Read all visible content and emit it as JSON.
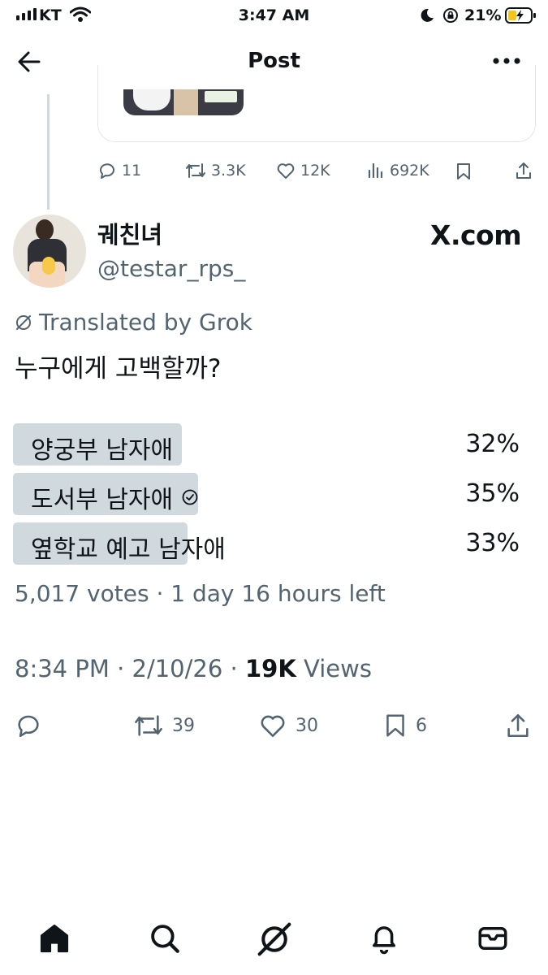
{
  "status_bar": {
    "carrier": "KT",
    "time": "3:47 AM",
    "battery": "21%"
  },
  "nav": {
    "title": "Post"
  },
  "quoted_post_actions": {
    "replies": "11",
    "reposts": "3.3K",
    "likes": "12K",
    "views": "692K"
  },
  "author": {
    "name": "궤친녀",
    "handle": "@testar_rps_",
    "badge": "X.com"
  },
  "translated": "Translated by Grok",
  "tweet_text": "누구에게 고백할까?",
  "poll": {
    "options": [
      {
        "label": "양궁부 남자애",
        "percent": "32%",
        "value": 32,
        "selected": false
      },
      {
        "label": "도서부 남자애",
        "percent": "35%",
        "value": 35,
        "selected": true
      },
      {
        "label": "옆학교 예고 남자애",
        "percent": "33%",
        "value": 33,
        "selected": false
      }
    ],
    "summary": "5,017 votes · 1 day 16 hours left"
  },
  "post_meta": {
    "time_date": "8:34 PM · 2/10/26 · ",
    "views_count": "19K",
    "views_label": " Views"
  },
  "post_actions": {
    "reposts": "39",
    "likes": "30",
    "bookmarks": "6"
  },
  "colors": {
    "poll_fill": "#cfd9de",
    "secondary_text": "#536471",
    "primary_text": "#0f1419"
  },
  "tab_bar": {
    "icons": [
      "home-icon",
      "search-icon",
      "grok-icon",
      "notifications-icon",
      "messages-icon"
    ]
  }
}
